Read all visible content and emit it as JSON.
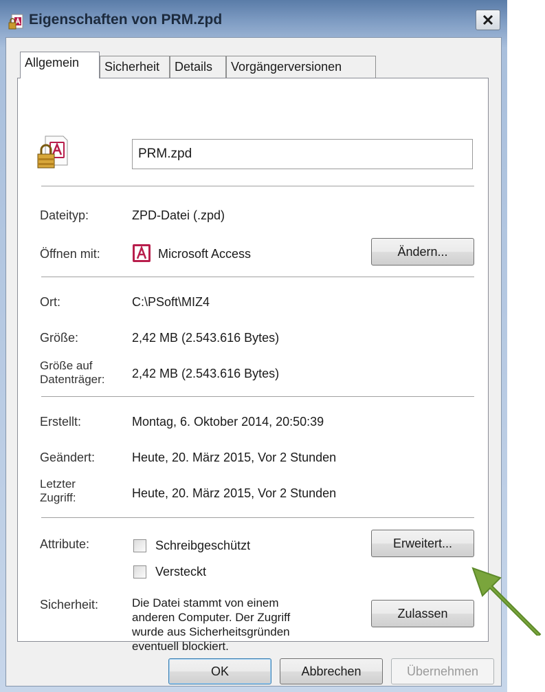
{
  "window": {
    "title": "Eigenschaften von PRM.zpd",
    "close_icon": "close-icon"
  },
  "tabs": [
    {
      "label": "Allgemein",
      "active": true
    },
    {
      "label": "Sicherheit",
      "active": false
    },
    {
      "label": "Details",
      "active": false
    },
    {
      "label": "Vorgängerversionen",
      "active": false
    }
  ],
  "general": {
    "file_icon": "access-file-locked-icon",
    "name": "PRM.zpd",
    "type_label": "Dateityp:",
    "type_value": "ZPD-Datei (.zpd)",
    "open_with_label": "Öffnen mit:",
    "open_with_app_icon": "access-app-icon",
    "open_with_value": "Microsoft Access",
    "change_button": "Ändern...",
    "location_label": "Ort:",
    "location_value": "C:\\PSoft\\MIZ4",
    "size_label": "Größe:",
    "size_value": "2,42 MB (2.543.616 Bytes)",
    "disk_size_label_1": "Größe auf",
    "disk_size_label_2": "Datenträger:",
    "disk_size_value": "2,42 MB (2.543.616 Bytes)",
    "created_label": "Erstellt:",
    "created_value": "Montag, 6. Oktober 2014, 20:50:39",
    "modified_label": "Geändert:",
    "modified_value": "Heute, 20. März 2015, Vor 2 Stunden",
    "accessed_label_1": "Letzter",
    "accessed_label_2": "Zugriff:",
    "accessed_value": "Heute, 20. März 2015, Vor 2 Stunden",
    "attributes_label": "Attribute:",
    "readonly_label": "Schreibgeschützt",
    "readonly_checked": false,
    "hidden_label": "Versteckt",
    "hidden_checked": false,
    "advanced_button": "Erweitert...",
    "security_label": "Sicherheit:",
    "security_text": [
      "Die Datei stammt von einem",
      "anderen Computer. Der Zugriff",
      "wurde aus Sicherheitsgründen",
      "eventuell blockiert."
    ],
    "unblock_button": "Zulassen"
  },
  "footer": {
    "ok": "OK",
    "cancel": "Abbrechen",
    "apply": "Übernehmen",
    "apply_disabled": true
  },
  "annotation": {
    "arrow_icon": "green-arrow-icon",
    "color": "#7aa53c"
  }
}
